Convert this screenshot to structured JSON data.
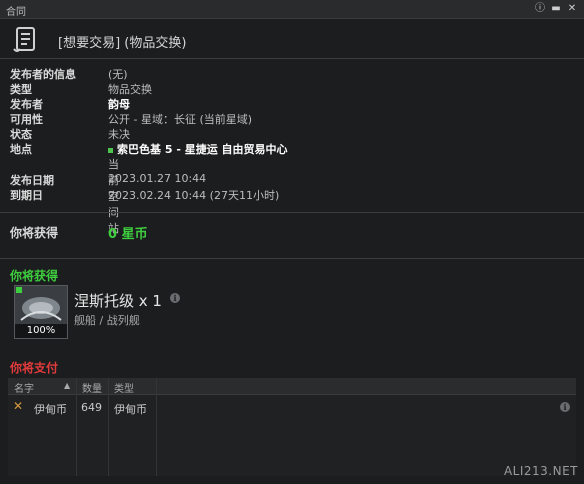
{
  "window": {
    "title": "合同"
  },
  "header": {
    "title": "[想要交易] (物品交换)"
  },
  "info": [
    {
      "key": "发布者的信息",
      "value": "(无)"
    },
    {
      "key": "类型",
      "value": "物品交换"
    },
    {
      "key": "发布者",
      "value": "韵母"
    },
    {
      "key": "可用性",
      "value": "公开 - 星域：长征 (当前星域)"
    },
    {
      "key": "状态",
      "value": "未决"
    },
    {
      "key": "地点",
      "value": "索巴色基 5 - 星捷运 自由贸易中心",
      "sub": "当前空间站"
    },
    {
      "key": "发布日期",
      "value": "2023.01.27 10:44"
    },
    {
      "key": "到期日",
      "value": "2023.02.24 10:44 (27天11小时)"
    }
  ],
  "receive_isk": {
    "label": "你将获得",
    "value": "0 星币"
  },
  "receive_items": {
    "title": "你将获得",
    "item": {
      "name": "涅斯托级 x 1",
      "type": "舰船 / 战列舰",
      "percent": "100%"
    }
  },
  "pay": {
    "title": "你将支付",
    "columns": [
      "名字",
      "数量",
      "类型"
    ],
    "rows": [
      {
        "name": "伊甸币",
        "qty": "649",
        "type": "伊甸币"
      }
    ]
  },
  "colors": {
    "green": "#3ecf3e",
    "red": "#e23b3b",
    "bg": "#1c1d1f"
  },
  "watermark": "ALI213.NET"
}
